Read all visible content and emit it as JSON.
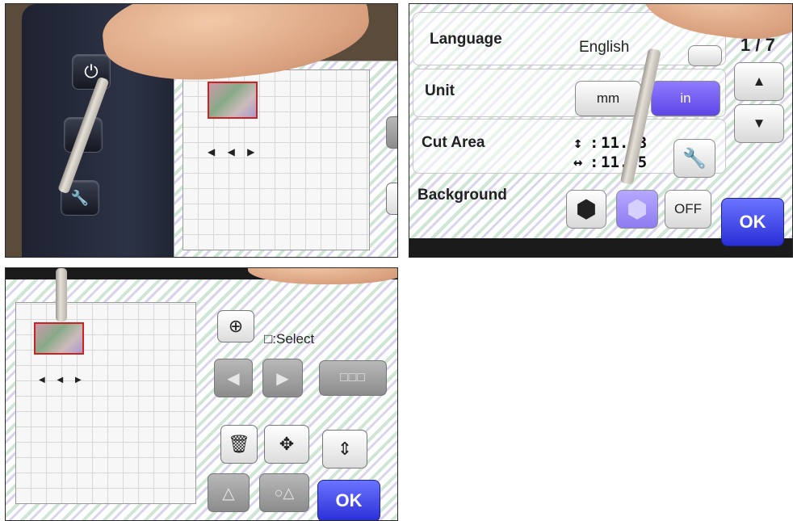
{
  "panel1": {
    "hardware_buttons": [
      {
        "name": "power",
        "glyph": "⏻"
      },
      {
        "name": "home",
        "glyph": "⌂"
      },
      {
        "name": "settings",
        "glyph": "🔧"
      }
    ],
    "mat_arrows": "◀ ◀ ▶",
    "mat_small_label": "■ ◀"
  },
  "panel2": {
    "rows": {
      "language": {
        "label": "Language",
        "value": "English"
      },
      "unit": {
        "label": "Unit",
        "option_mm": "mm",
        "option_inch": "in"
      },
      "cut_area": {
        "label": "Cut Area",
        "vertical_value": "11.73",
        "horizontal_value": "11.65",
        "vertical_symbol": "↕",
        "horizontal_symbol": "↔"
      },
      "background": {
        "label": "Background",
        "off_label": "OFF"
      }
    },
    "page_indicator": "1 / 7",
    "ok_label": "OK"
  },
  "panel3": {
    "select_label": "□:Select",
    "ok_label": "OK",
    "icons": {
      "zoom": "⊕",
      "left": "◀",
      "right": "▶",
      "group": "□□□",
      "trash": "🗑",
      "move": "✥",
      "resize": "⇕",
      "shape": "△",
      "shape_group": "○△"
    }
  },
  "colors": {
    "ok_button": "#3a40e6",
    "stripe_green": "#cfe6d6",
    "stripe_purple": "#d9d4ec",
    "selection_red": "#d02020"
  }
}
